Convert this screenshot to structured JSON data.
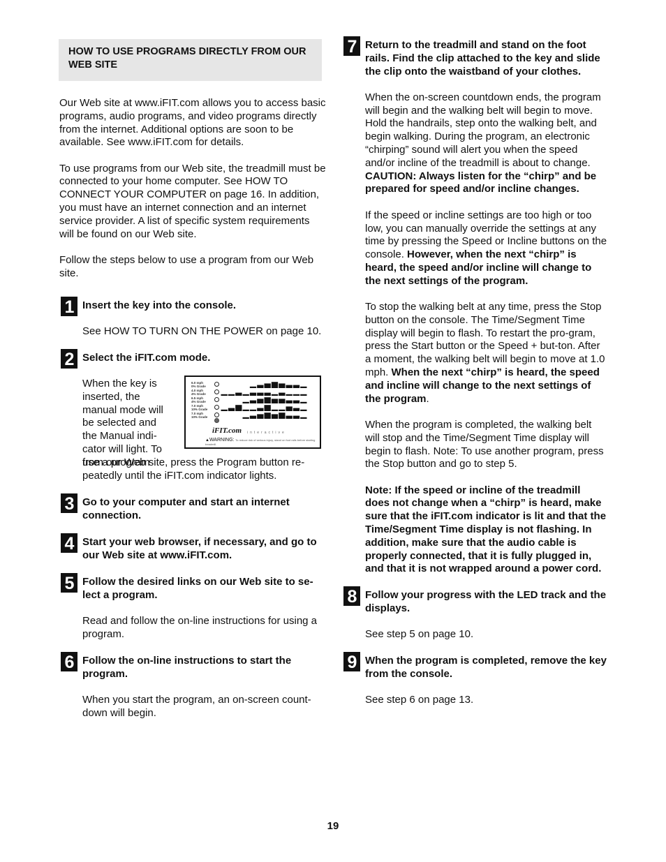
{
  "section_heading": "HOW TO USE PROGRAMS DIRECTLY FROM OUR WEB SITE",
  "intro": [
    "Our Web site at www.iFIT.com allows you to access basic programs, audio programs, and video programs directly from the internet. Additional options are soon to be available. See www.iFIT.com for details.",
    "To use programs from our Web site, the treadmill must be connected to your home computer. See HOW TO CONNECT YOUR COMPUTER on page 16. In addition, you must have an internet connection and an internet service provider. A list of specific system requirements will be found on our Web site.",
    "Follow the steps below to use a program from our Web site."
  ],
  "steps": [
    {
      "number": "1",
      "title": "Insert the key into the console.",
      "body": "See HOW TO TURN ON THE POWER on page 10."
    },
    {
      "number": "2",
      "title": "Select the iFIT.com mode.",
      "body_beside_figure": "When the key is inserted, the manual mode will be selected and the Manual indi-cator will light. To use a program",
      "body_after_figure": "from our Web site, press the Program button re-peatedly until the iFIT.com indicator lights."
    },
    {
      "number": "3",
      "title": "Go to your computer and start an internet connection."
    },
    {
      "number": "4",
      "title": "Start your web browser, if necessary, and go to our Web site at www.iFIT.com."
    },
    {
      "number": "5",
      "title": "Follow the desired links on our Web site to se-lect a program.",
      "body": "Read and follow the on-line instructions for using a program."
    },
    {
      "number": "6",
      "title": "Follow the on-line instructions to start the program.",
      "body": "When you start the program, an on-screen count-down will begin."
    },
    {
      "number": "7",
      "title": "Return to the treadmill and stand on the foot rails. Find the clip attached to the key and slide the clip onto the waistband of your clothes.",
      "paragraphs": [
        {
          "normal": "When the on-screen countdown ends, the program will begin and the walking belt will begin to move. Hold the handrails, step onto the walking belt, and begin walking. During the program, an electronic “chirping” sound will alert you when the speed and/or incline of the treadmill is about to change. ",
          "bold": "CAUTION: Always listen for the “chirp” and be prepared for speed and/or incline changes.",
          "tail": ""
        },
        {
          "normal": "If the speed or incline settings are too high or too low, you can manually override the settings at any time by pressing the Speed or Incline buttons on the console. ",
          "bold": "However, when the next “chirp” is heard, the speed and/or incline will change to the next settings of the program.",
          "tail": ""
        },
        {
          "normal": "To stop the walking belt at any time, press the Stop button on the console. The Time/Segment Time display will begin to flash. To restart the pro-gram, press the Start button or the Speed + but-ton. After a moment, the walking belt will begin to move at 1.0 mph. ",
          "bold": "When the next “chirp” is heard, the speed and incline will change to the next settings of the program",
          "tail": "."
        },
        {
          "normal": "When the program is completed, the walking belt will stop and the Time/Segment Time display will begin to flash. Note: To use another program, press the Stop button and go to step 5.",
          "bold": "",
          "tail": ""
        },
        {
          "normal": "",
          "bold": "Note: If the speed or incline of the treadmill does not change when a “chirp” is heard, make sure that the iFIT.com indicator is lit and that the Time/Segment Time display is not flashing. In addition, make sure that the audio cable is properly connected, that it is fully plugged in, and that it is not wrapped around a power cord.",
          "tail": ""
        }
      ]
    },
    {
      "number": "8",
      "title": "Follow your progress with the LED track and the displays.",
      "body": "See step 5 on page 10."
    },
    {
      "number": "9",
      "title": "When the program is completed, remove the key from the console.",
      "body": "See step 6 on page 13."
    }
  ],
  "console_figure": {
    "programs": [
      {
        "speed": "6.0 mph",
        "grade": "0% Grade",
        "lit": false
      },
      {
        "speed": "4.0 mph",
        "grade": "4% Grade",
        "lit": false
      },
      {
        "speed": "6.5 mph",
        "grade": "4% Grade",
        "lit": false
      },
      {
        "speed": "7.0 mph",
        "grade": "10% Grade",
        "lit": false
      },
      {
        "speed": "7.0 mph",
        "grade": "10% Grade",
        "lit": false
      }
    ],
    "ifit_indicator_lit": true,
    "logo_text": "iFIT.com",
    "logo_tagline": "interactive",
    "warning_title": "WARNING:",
    "warning_text": "To reduce risk of serious injury, stand on foot rails before starting treadmill."
  },
  "page_number": "19"
}
